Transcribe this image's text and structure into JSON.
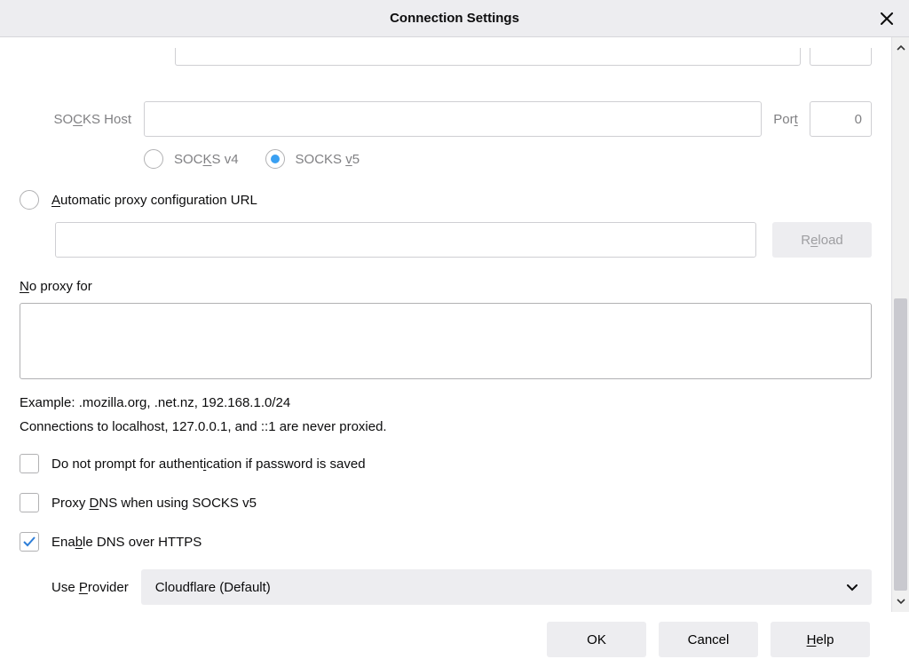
{
  "title": "Connection Settings",
  "socks": {
    "host_label": "SOCKS Host",
    "host_value": "",
    "port_label": "Port",
    "port_value": "0",
    "v4_label": "SOCKS v4",
    "v5_label": "SOCKS v5",
    "selected": "v5"
  },
  "auto": {
    "label": "Automatic proxy configuration URL",
    "url_value": "",
    "reload_label": "Reload"
  },
  "noproxy": {
    "label": "No proxy for",
    "value": "",
    "example": "Example: .mozilla.org, .net.nz, 192.168.1.0/24",
    "local_note": "Connections to localhost, 127.0.0.1, and ::1 are never proxied."
  },
  "checks": {
    "no_prompt": {
      "label": "Do not prompt for authentication if password is saved",
      "checked": false
    },
    "proxy_dns": {
      "label": "Proxy DNS when using SOCKS v5",
      "checked": false
    },
    "enable_doh": {
      "label": "Enable DNS over HTTPS",
      "checked": true
    }
  },
  "provider": {
    "label": "Use Provider",
    "value": "Cloudflare (Default)"
  },
  "buttons": {
    "ok": "OK",
    "cancel": "Cancel",
    "help": "Help"
  }
}
